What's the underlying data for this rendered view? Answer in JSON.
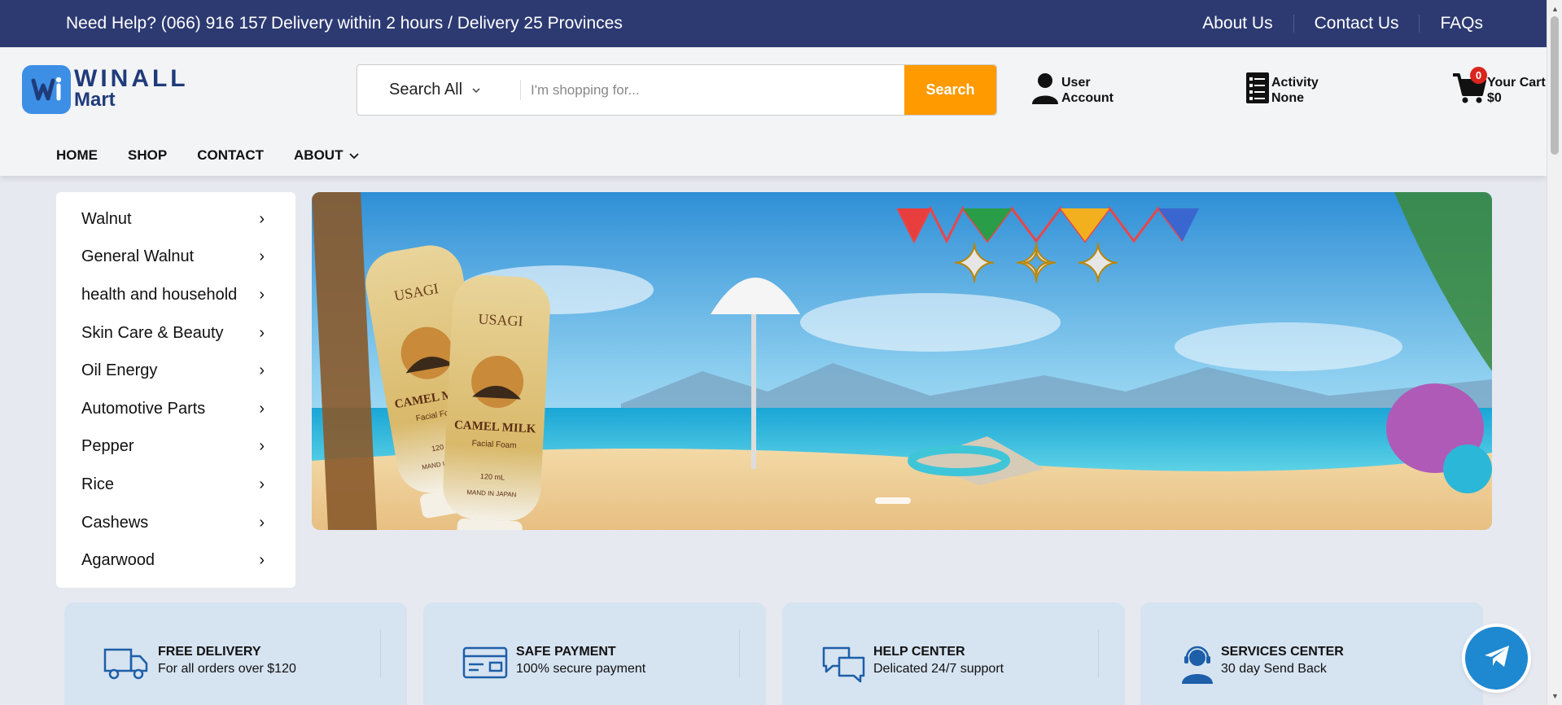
{
  "topbar": {
    "help": "Need Help? (066) 916 157",
    "delivery": "Delivery within 2 hours / Delivery 25 Provinces",
    "links": [
      "About Us",
      "Contact Us",
      "FAQs"
    ]
  },
  "logo": {
    "line1": "WINALL",
    "line2": "Mart"
  },
  "search": {
    "category": "Search All",
    "placeholder": "I'm shopping for...",
    "button": "Search"
  },
  "user": {
    "line1": "User",
    "line2": "Account"
  },
  "activity": {
    "line1": "Activity",
    "line2": "None"
  },
  "cart": {
    "count": "0",
    "line1": "Your Cart",
    "line2": "$0"
  },
  "nav": {
    "home": "HOME",
    "shop": "SHOP",
    "contact": "CONTACT",
    "about": "ABOUT"
  },
  "categories": [
    "Walnut",
    "General Walnut",
    "health and household",
    "Skin Care & Beauty",
    "Oil Energy",
    "Automotive Parts",
    "Pepper",
    "Rice",
    "Cashews",
    "Agarwood"
  ],
  "banner": {
    "product_brand": "USAGI",
    "product_name": "CAMEL MILK",
    "product_sub": "Facial Foam",
    "product_volume": "120 mL",
    "product_origin": "MAND IN JAPAN"
  },
  "features": [
    {
      "title": "FREE DELIVERY",
      "subtitle": "For all orders over $120",
      "icon": "truck-icon"
    },
    {
      "title": "SAFE PAYMENT",
      "subtitle": "100% secure payment",
      "icon": "credit-card-icon"
    },
    {
      "title": "HELP CENTER",
      "subtitle": "Delicated 24/7 support",
      "icon": "chat-icon"
    },
    {
      "title": "SERVICES CENTER",
      "subtitle": "30 day Send Back",
      "icon": "support-agent-icon"
    }
  ],
  "colors": {
    "topbar": "#2d3a72",
    "accent": "#ff9a00",
    "logo_blue": "#3d8fe6",
    "feature_bg": "#d6e3f1",
    "telegram": "#1e88d0",
    "cart_badge": "#d9251d"
  }
}
